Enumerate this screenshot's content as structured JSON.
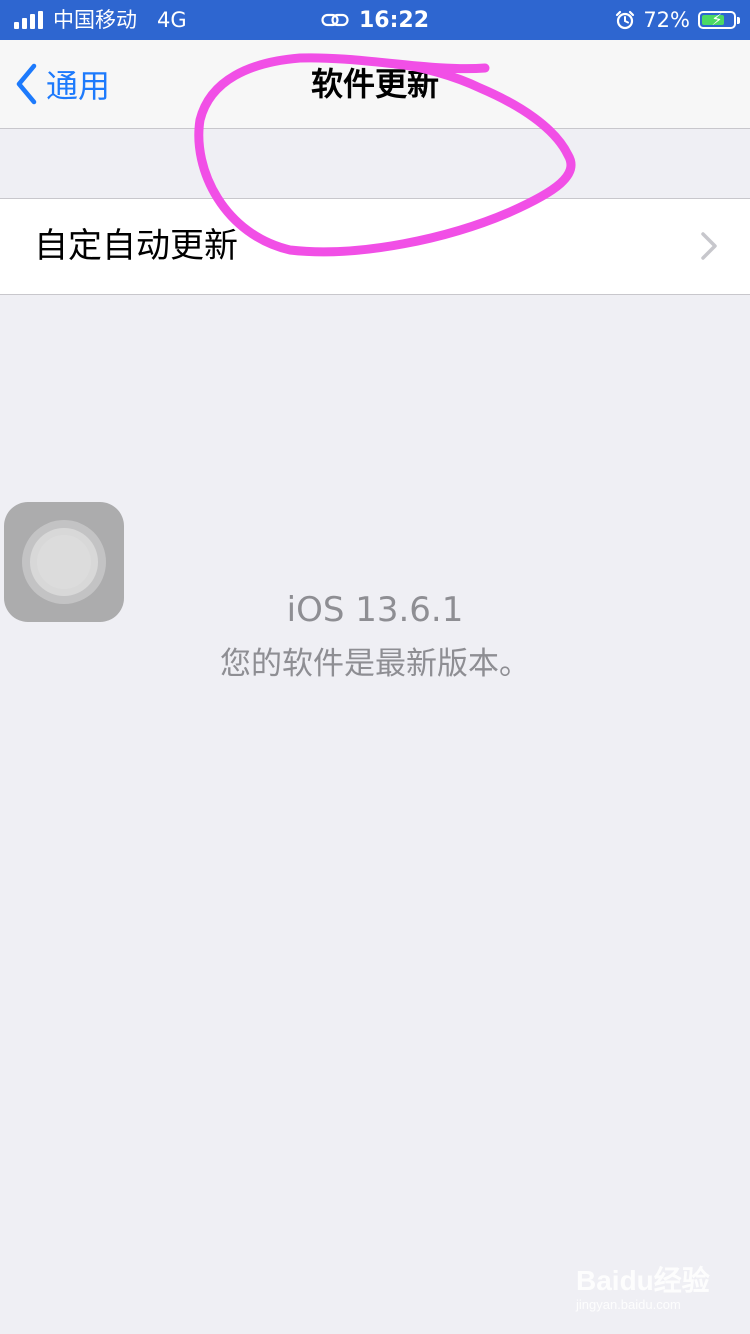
{
  "status_bar": {
    "carrier": "中国移动",
    "network": "4G",
    "time": "16:22",
    "battery_percent": "72%",
    "battery_level": 0.72,
    "background": "#2e66d0"
  },
  "nav": {
    "back_label": "通用",
    "title": "软件更新",
    "accent": "#1d7afc"
  },
  "settings": {
    "auto_update_label": "自定自动更新"
  },
  "update_status": {
    "version": "iOS 13.6.1",
    "message": "您的软件是最新版本。"
  },
  "icons": [
    "signal-icon",
    "link-icon",
    "alarm-icon",
    "battery-icon",
    "chevron-left-icon",
    "chevron-right-icon",
    "assistive-touch-icon"
  ],
  "annotation": {
    "color": "#f14fe6"
  },
  "watermark": {
    "logo": "Baidu经验",
    "site": "jingyan.baidu.com"
  }
}
